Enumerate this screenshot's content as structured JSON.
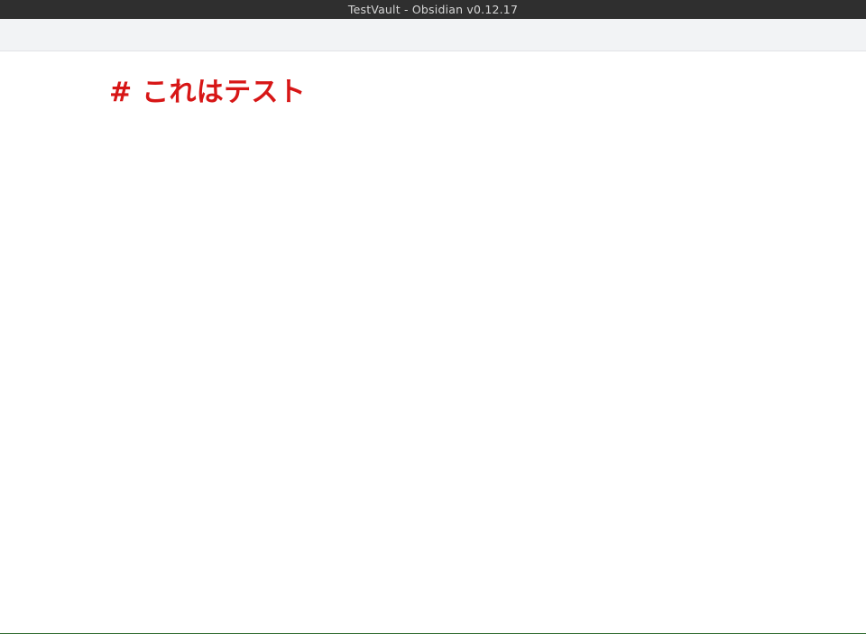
{
  "window": {
    "title": "TestVault - Obsidian v0.12.17"
  },
  "editor": {
    "lines": [
      "# これはテスト"
    ]
  },
  "colors": {
    "titlebar_bg": "#2f2f2f",
    "toolbar_bg": "#f2f3f5",
    "heading_color": "#d71616",
    "editor_bg": "#ffffff"
  }
}
